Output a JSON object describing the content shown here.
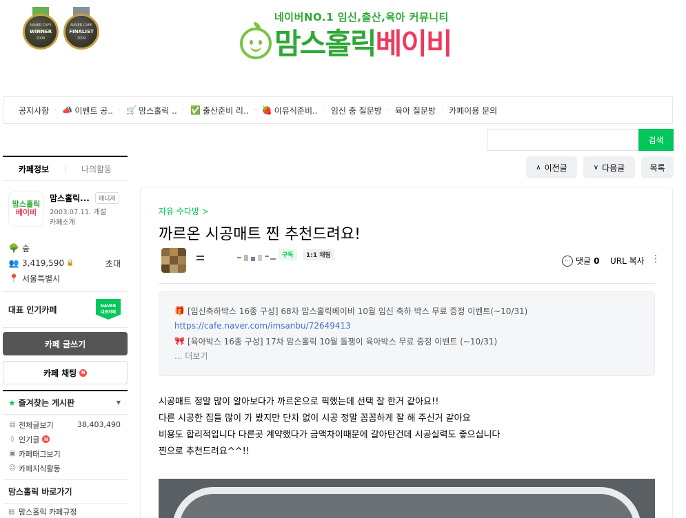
{
  "header": {
    "medals": [
      {
        "top": "NAVER CAFE",
        "label": "WINNER",
        "year": "2008",
        "color": "#3a3a30",
        "ribbon": "#6ab04c"
      },
      {
        "top": "NAVER CAFE",
        "label": "FINALIST",
        "year": "2009",
        "color": "#3a3a36",
        "ribbon": "#8a8f94"
      }
    ],
    "banner_subtitle": "네이버NO.1 임신,출산,육아 커뮤니티",
    "banner_title_green": "맘스홀릭",
    "banner_title_red": "베이비"
  },
  "menu": [
    {
      "icon": "",
      "label": "공지사항"
    },
    {
      "icon": "📣",
      "label": "이벤트 공.."
    },
    {
      "icon": "🛒",
      "label": "맘스홀릭 .."
    },
    {
      "icon": "✅",
      "label": "출산준비 리.."
    },
    {
      "icon": "🍓",
      "label": "이유식준비.."
    },
    {
      "icon": "",
      "label": "임신 중 질문방"
    },
    {
      "icon": "",
      "label": "육아 질문방"
    },
    {
      "icon": "",
      "label": "카페이용 문의"
    }
  ],
  "search": {
    "placeholder": "",
    "button": "검색"
  },
  "nav": {
    "prev": "이전글",
    "next": "다음글",
    "list": "목록"
  },
  "sidebar": {
    "tabs": {
      "info": "카페정보",
      "activity": "나의활동"
    },
    "cafe": {
      "logo_line1": "맘스홀릭",
      "logo_line2": "베이비",
      "name": "맘스홀릭...",
      "badge": "매니저",
      "since": "2003.07.11. 개설",
      "intro": "카페소개"
    },
    "stats": {
      "level": "숲",
      "members": "3,419,590",
      "invite": "초대",
      "location": "서울특별시"
    },
    "popular": {
      "label": "대표 인기카페",
      "badge_top": "NAVER",
      "badge_bottom": "대표카페"
    },
    "write_button": "카페 글쓰기",
    "chat_button": "카페 채팅",
    "chat_badge": "N",
    "favorites": {
      "title": "즐겨찾는 게시판"
    },
    "boards": [
      {
        "icon": "▤",
        "label": "전체글보기",
        "count": "38,403,490"
      },
      {
        "icon": "◊",
        "label": "인기글",
        "count": ""
      },
      {
        "icon": "▣",
        "label": "카페태그보기",
        "count": ""
      },
      {
        "icon": "☺",
        "label": "카페지식활동",
        "count": ""
      }
    ],
    "popular_badge": "N",
    "shortcut_title": "맘스홀릭 바로가기",
    "shortcut_item": "맘스홀릭 카페규정"
  },
  "article": {
    "board": "자유 수다방 >",
    "title": "까르온 시공매트 찐 추천드려요!",
    "subscribe": "구독",
    "chat": "1:1 채팅",
    "comment_label": "댓글",
    "comment_count": "0",
    "url_copy": "URL 복사",
    "notice": {
      "line1_icon": "🎁",
      "line1": "[임신축하박스 16종 구성] 68차 맘스홀릭베이비 10월 임신 축하 박스 무료 증정 이벤트(~10/31)",
      "link": "https://cafe.naver.com/imsanbu/72649413",
      "line2_icon": "🎀",
      "line2": "[육아박스 16종 구성] 17차 맘스홀릭 10월 돌쟁이 육아박스 무료 증정 이벤트 (~10/31)",
      "more": "... 더보기"
    },
    "body": [
      "시공매트 정말 많이 알아보다가 까르온으로 픽했는데 선택 잘 한거 같아요!!",
      "다른 시공한 집들 많이 가 봤지만 단차 없이 시공 정말 꼼꼼하게 잘 해 주신거 같아요",
      "비용도 합리적입니다 다른곳 계약했다가 금액차이때문에 갈아탄건데 시공실력도 좋으십니다",
      "찐으로 추천드려요^^!!"
    ]
  },
  "colors": {
    "naver_green": "#03c75a",
    "brand_green": "#2ea836",
    "brand_red": "#ec3b5d"
  }
}
